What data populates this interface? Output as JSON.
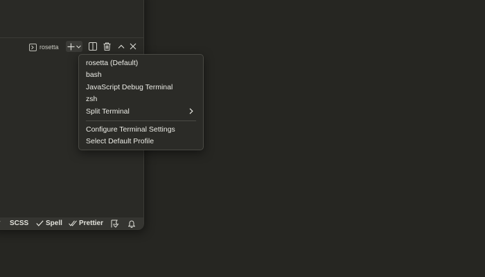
{
  "terminal": {
    "tab_label": "rosetta"
  },
  "menu": {
    "items": [
      {
        "label": "rosetta (Default)"
      },
      {
        "label": "bash"
      },
      {
        "label": "JavaScript Debug Terminal"
      },
      {
        "label": "zsh"
      },
      {
        "label": "Split Terminal"
      }
    ],
    "items2": [
      {
        "label": "Configure Terminal Settings"
      },
      {
        "label": "Select Default Profile"
      }
    ]
  },
  "statusbar": {
    "lang": "SCSS",
    "spell": "Spell",
    "prettier": "Prettier"
  },
  "colors": {
    "desktop": "#262622",
    "panel": "#2a2a26",
    "statusbar": "#353531",
    "menu_bg": "#2b2b27"
  },
  "icons": [
    "terminal-icon",
    "plus-icon",
    "chevron-down-icon",
    "split-icon",
    "trash-icon",
    "chevron-up-icon",
    "close-icon",
    "check-icon",
    "double-check-icon",
    "feedback-icon",
    "bell-icon",
    "chevron-right-icon"
  ]
}
